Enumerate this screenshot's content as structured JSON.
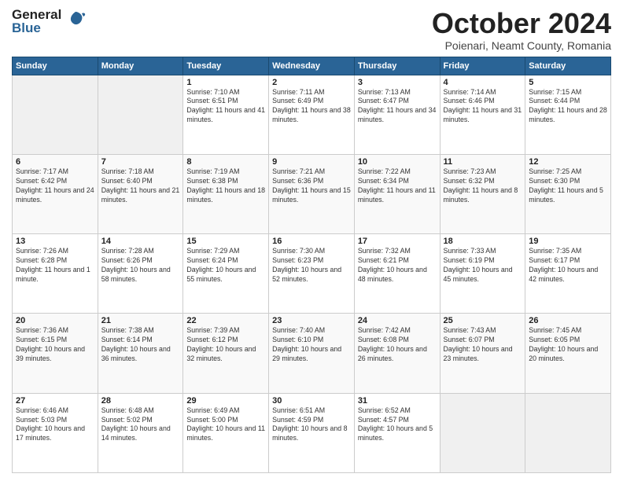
{
  "header": {
    "logo_general": "General",
    "logo_blue": "Blue",
    "month_title": "October 2024",
    "subtitle": "Poienari, Neamt County, Romania"
  },
  "weekdays": [
    "Sunday",
    "Monday",
    "Tuesday",
    "Wednesday",
    "Thursday",
    "Friday",
    "Saturday"
  ],
  "weeks": [
    [
      {
        "day": "",
        "empty": true
      },
      {
        "day": "",
        "empty": true
      },
      {
        "day": "1",
        "sunrise": "Sunrise: 7:10 AM",
        "sunset": "Sunset: 6:51 PM",
        "daylight": "Daylight: 11 hours and 41 minutes."
      },
      {
        "day": "2",
        "sunrise": "Sunrise: 7:11 AM",
        "sunset": "Sunset: 6:49 PM",
        "daylight": "Daylight: 11 hours and 38 minutes."
      },
      {
        "day": "3",
        "sunrise": "Sunrise: 7:13 AM",
        "sunset": "Sunset: 6:47 PM",
        "daylight": "Daylight: 11 hours and 34 minutes."
      },
      {
        "day": "4",
        "sunrise": "Sunrise: 7:14 AM",
        "sunset": "Sunset: 6:46 PM",
        "daylight": "Daylight: 11 hours and 31 minutes."
      },
      {
        "day": "5",
        "sunrise": "Sunrise: 7:15 AM",
        "sunset": "Sunset: 6:44 PM",
        "daylight": "Daylight: 11 hours and 28 minutes."
      }
    ],
    [
      {
        "day": "6",
        "sunrise": "Sunrise: 7:17 AM",
        "sunset": "Sunset: 6:42 PM",
        "daylight": "Daylight: 11 hours and 24 minutes."
      },
      {
        "day": "7",
        "sunrise": "Sunrise: 7:18 AM",
        "sunset": "Sunset: 6:40 PM",
        "daylight": "Daylight: 11 hours and 21 minutes."
      },
      {
        "day": "8",
        "sunrise": "Sunrise: 7:19 AM",
        "sunset": "Sunset: 6:38 PM",
        "daylight": "Daylight: 11 hours and 18 minutes."
      },
      {
        "day": "9",
        "sunrise": "Sunrise: 7:21 AM",
        "sunset": "Sunset: 6:36 PM",
        "daylight": "Daylight: 11 hours and 15 minutes."
      },
      {
        "day": "10",
        "sunrise": "Sunrise: 7:22 AM",
        "sunset": "Sunset: 6:34 PM",
        "daylight": "Daylight: 11 hours and 11 minutes."
      },
      {
        "day": "11",
        "sunrise": "Sunrise: 7:23 AM",
        "sunset": "Sunset: 6:32 PM",
        "daylight": "Daylight: 11 hours and 8 minutes."
      },
      {
        "day": "12",
        "sunrise": "Sunrise: 7:25 AM",
        "sunset": "Sunset: 6:30 PM",
        "daylight": "Daylight: 11 hours and 5 minutes."
      }
    ],
    [
      {
        "day": "13",
        "sunrise": "Sunrise: 7:26 AM",
        "sunset": "Sunset: 6:28 PM",
        "daylight": "Daylight: 11 hours and 1 minute."
      },
      {
        "day": "14",
        "sunrise": "Sunrise: 7:28 AM",
        "sunset": "Sunset: 6:26 PM",
        "daylight": "Daylight: 10 hours and 58 minutes."
      },
      {
        "day": "15",
        "sunrise": "Sunrise: 7:29 AM",
        "sunset": "Sunset: 6:24 PM",
        "daylight": "Daylight: 10 hours and 55 minutes."
      },
      {
        "day": "16",
        "sunrise": "Sunrise: 7:30 AM",
        "sunset": "Sunset: 6:23 PM",
        "daylight": "Daylight: 10 hours and 52 minutes."
      },
      {
        "day": "17",
        "sunrise": "Sunrise: 7:32 AM",
        "sunset": "Sunset: 6:21 PM",
        "daylight": "Daylight: 10 hours and 48 minutes."
      },
      {
        "day": "18",
        "sunrise": "Sunrise: 7:33 AM",
        "sunset": "Sunset: 6:19 PM",
        "daylight": "Daylight: 10 hours and 45 minutes."
      },
      {
        "day": "19",
        "sunrise": "Sunrise: 7:35 AM",
        "sunset": "Sunset: 6:17 PM",
        "daylight": "Daylight: 10 hours and 42 minutes."
      }
    ],
    [
      {
        "day": "20",
        "sunrise": "Sunrise: 7:36 AM",
        "sunset": "Sunset: 6:15 PM",
        "daylight": "Daylight: 10 hours and 39 minutes."
      },
      {
        "day": "21",
        "sunrise": "Sunrise: 7:38 AM",
        "sunset": "Sunset: 6:14 PM",
        "daylight": "Daylight: 10 hours and 36 minutes."
      },
      {
        "day": "22",
        "sunrise": "Sunrise: 7:39 AM",
        "sunset": "Sunset: 6:12 PM",
        "daylight": "Daylight: 10 hours and 32 minutes."
      },
      {
        "day": "23",
        "sunrise": "Sunrise: 7:40 AM",
        "sunset": "Sunset: 6:10 PM",
        "daylight": "Daylight: 10 hours and 29 minutes."
      },
      {
        "day": "24",
        "sunrise": "Sunrise: 7:42 AM",
        "sunset": "Sunset: 6:08 PM",
        "daylight": "Daylight: 10 hours and 26 minutes."
      },
      {
        "day": "25",
        "sunrise": "Sunrise: 7:43 AM",
        "sunset": "Sunset: 6:07 PM",
        "daylight": "Daylight: 10 hours and 23 minutes."
      },
      {
        "day": "26",
        "sunrise": "Sunrise: 7:45 AM",
        "sunset": "Sunset: 6:05 PM",
        "daylight": "Daylight: 10 hours and 20 minutes."
      }
    ],
    [
      {
        "day": "27",
        "sunrise": "Sunrise: 6:46 AM",
        "sunset": "Sunset: 5:03 PM",
        "daylight": "Daylight: 10 hours and 17 minutes."
      },
      {
        "day": "28",
        "sunrise": "Sunrise: 6:48 AM",
        "sunset": "Sunset: 5:02 PM",
        "daylight": "Daylight: 10 hours and 14 minutes."
      },
      {
        "day": "29",
        "sunrise": "Sunrise: 6:49 AM",
        "sunset": "Sunset: 5:00 PM",
        "daylight": "Daylight: 10 hours and 11 minutes."
      },
      {
        "day": "30",
        "sunrise": "Sunrise: 6:51 AM",
        "sunset": "Sunset: 4:59 PM",
        "daylight": "Daylight: 10 hours and 8 minutes."
      },
      {
        "day": "31",
        "sunrise": "Sunrise: 6:52 AM",
        "sunset": "Sunset: 4:57 PM",
        "daylight": "Daylight: 10 hours and 5 minutes."
      },
      {
        "day": "",
        "empty": true
      },
      {
        "day": "",
        "empty": true
      }
    ]
  ]
}
